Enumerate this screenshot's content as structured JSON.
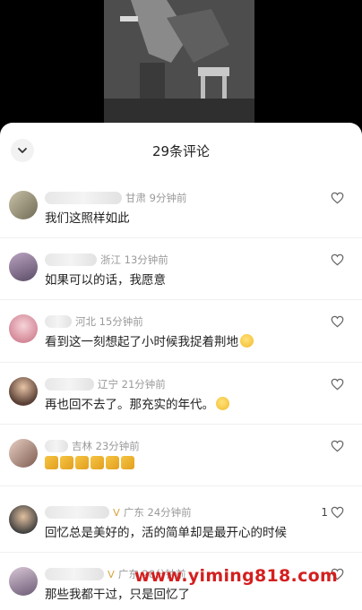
{
  "sheet": {
    "title": "29条评论"
  },
  "comments": [
    {
      "location": "甘肃",
      "time": "9分钟前",
      "text": "我们这照样如此",
      "likes": ""
    },
    {
      "location": "浙江",
      "time": "13分钟前",
      "text": "如果可以的话，我愿意",
      "likes": ""
    },
    {
      "location": "河北",
      "time": "15分钟前",
      "text": "看到这一刻想起了小时候我捉着荆地",
      "likes": ""
    },
    {
      "location": "辽宁",
      "time": "21分钟前",
      "text": "再也回不去了。那充实的年代。",
      "likes": ""
    },
    {
      "location": "吉林",
      "time": "23分钟前",
      "text": "",
      "likes": ""
    },
    {
      "location": "广东",
      "time": "24分钟前",
      "text": "回忆总是美好的，活的简单却是最开心的时候",
      "likes": "1"
    },
    {
      "location": "广东",
      "time": "28分钟前",
      "text": "那些我都干过，只是回忆了",
      "likes": ""
    }
  ],
  "watermark": "www.yiming818.com",
  "icons": {
    "collapse": "chevron-down-icon",
    "like": "heart-outline-icon"
  },
  "colors": {
    "watermark": "#d41f1f",
    "meta_text": "#9a9a9a"
  }
}
